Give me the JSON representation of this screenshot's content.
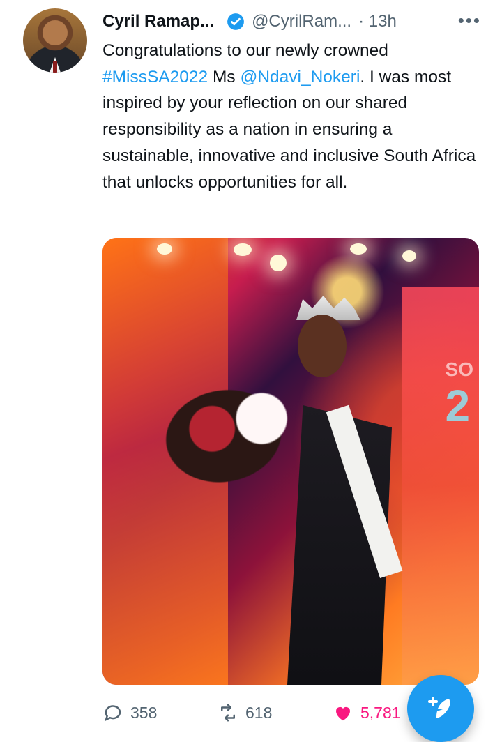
{
  "author": {
    "name": "Cyril Ramap...",
    "handle": "@CyrilRam...",
    "time": "· 13h",
    "more": "•••"
  },
  "tweet": {
    "line1": "Congratulations to our newly crowned",
    "hashtag": "#MissSA2022",
    "middle": " Ms ",
    "mention": "@Ndavi_Nokeri",
    "rest": ". I was most inspired by your reflection on our shared responsibility as a nation in ensuring a sustainable, innovative and inclusive South Africa that unlocks opportunities for all."
  },
  "actions": {
    "replies": "358",
    "retweets": "618",
    "likes": "5,781"
  },
  "colors": {
    "accent": "#1d9bf0",
    "like": "#f91880",
    "muted": "#536471"
  }
}
